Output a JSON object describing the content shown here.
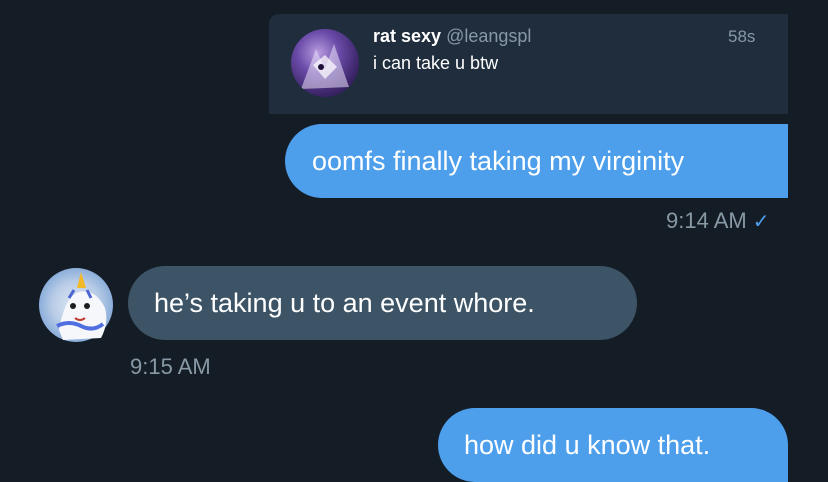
{
  "quote": {
    "name": "rat sexy",
    "handle": "@leangspl",
    "time": "58s",
    "text": "i can take u btw"
  },
  "messages": [
    {
      "direction": "outgoing",
      "text": "oomfs finally taking my virginity",
      "time": "9:14 AM",
      "status_icon": "check-icon"
    },
    {
      "direction": "incoming",
      "text": "he’s taking u to an event whore.",
      "time": "9:15 AM"
    },
    {
      "direction": "outgoing",
      "text": "how did u know that."
    }
  ],
  "colors": {
    "background": "#141c26",
    "outgoing_bubble": "#4d9fec",
    "incoming_bubble": "#3d5466",
    "quote_card": "#1f2d3d",
    "meta_text": "#8899a6"
  }
}
